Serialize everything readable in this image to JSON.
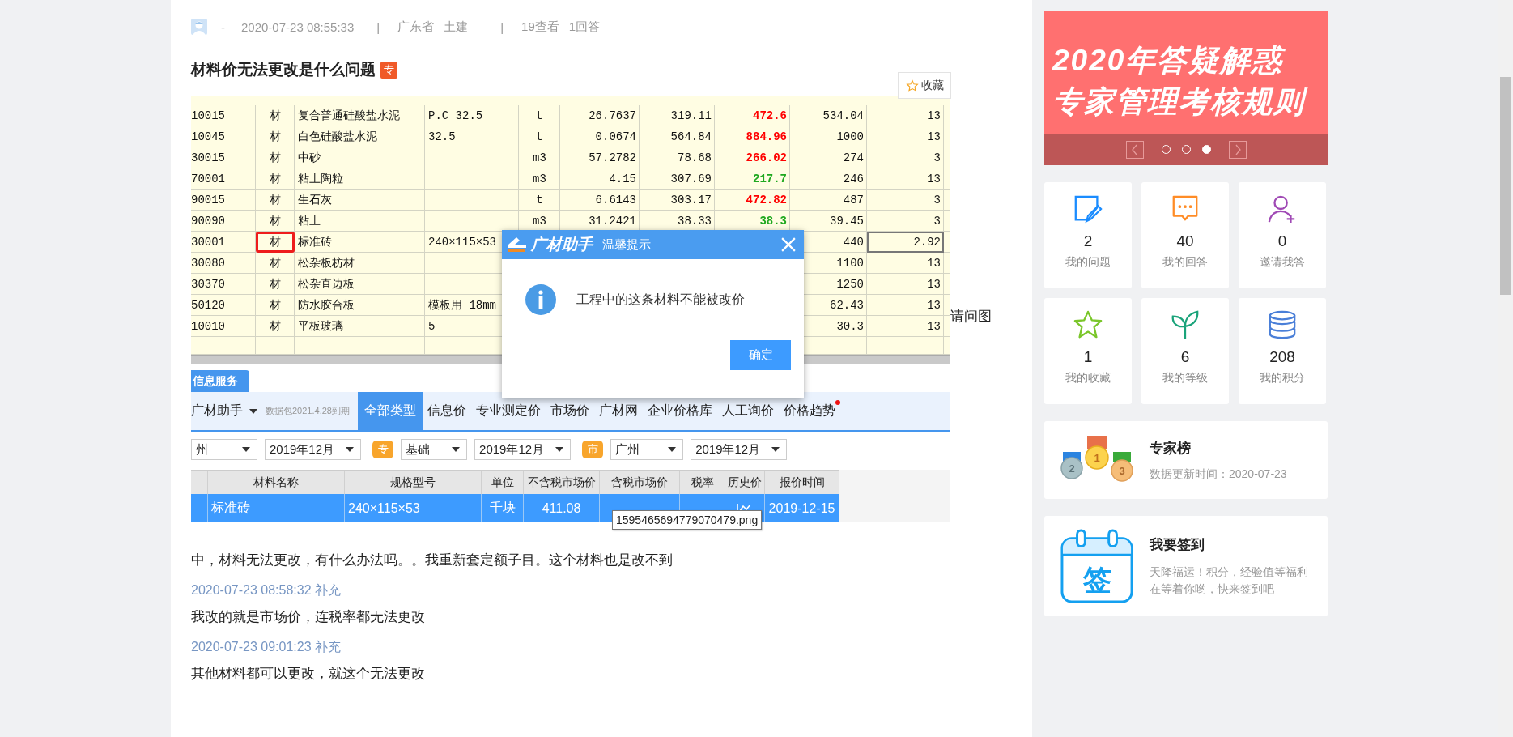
{
  "question": {
    "meta": [
      {
        "kind": "author",
        "text": "-"
      },
      {
        "kind": "time",
        "text": "2020-07-23 08:55:33"
      },
      {
        "kind": "separator",
        "text": "|"
      },
      {
        "kind": "tag",
        "text": "广东省"
      },
      {
        "kind": "tag",
        "text": "土建"
      },
      {
        "kind": "separator",
        "text": "|"
      },
      {
        "kind": "tag",
        "text": "19查看"
      },
      {
        "kind": "tag",
        "text": "1回答"
      }
    ],
    "title": "材料价无法更改是什么问题",
    "badge": "专",
    "favorite_button": "收藏",
    "lead_text": "请问图",
    "screenshot": {
      "price_table": {
        "rows": [
          {
            "flagged": false,
            "focused": false,
            "cells": [
              {
                "text": "10015"
              },
              {
                "text": "材"
              },
              {
                "text": "复合普通硅酸盐水泥"
              },
              {
                "text": "P.C 32.5"
              },
              {
                "text": "t"
              },
              {
                "text": "26.7637"
              },
              {
                "text": "319.11"
              },
              {
                "text": "472.6",
                "color": "#ff0000"
              },
              {
                "text": "534.04"
              },
              {
                "text": "13"
              }
            ]
          },
          {
            "flagged": false,
            "focused": false,
            "cells": [
              {
                "text": "10045"
              },
              {
                "text": "材"
              },
              {
                "text": "白色硅酸盐水泥"
              },
              {
                "text": "32.5"
              },
              {
                "text": "t"
              },
              {
                "text": "0.0674"
              },
              {
                "text": "564.84"
              },
              {
                "text": "884.96",
                "color": "#ff0000"
              },
              {
                "text": "1000"
              },
              {
                "text": "13"
              }
            ]
          },
          {
            "flagged": false,
            "focused": false,
            "cells": [
              {
                "text": "30015"
              },
              {
                "text": "材"
              },
              {
                "text": "中砂"
              },
              {},
              {
                "text": "m3"
              },
              {
                "text": "57.2782"
              },
              {
                "text": "78.68"
              },
              {
                "text": "266.02",
                "color": "#ff0000"
              },
              {
                "text": "274"
              },
              {
                "text": "3"
              }
            ]
          },
          {
            "flagged": false,
            "focused": false,
            "cells": [
              {
                "text": "70001"
              },
              {
                "text": "材"
              },
              {
                "text": "粘土陶粒"
              },
              {},
              {
                "text": "m3"
              },
              {
                "text": "4.15"
              },
              {
                "text": "307.69"
              },
              {
                "text": "217.7",
                "color": "#1fa81f"
              },
              {
                "text": "246"
              },
              {
                "text": "13"
              }
            ]
          },
          {
            "flagged": false,
            "focused": false,
            "cells": [
              {
                "text": "90015"
              },
              {
                "text": "材"
              },
              {
                "text": "生石灰"
              },
              {},
              {
                "text": "t"
              },
              {
                "text": "6.6143"
              },
              {
                "text": "303.17"
              },
              {
                "text": "472.82",
                "color": "#ff0000"
              },
              {
                "text": "487"
              },
              {
                "text": "3"
              }
            ]
          },
          {
            "flagged": false,
            "focused": false,
            "cells": [
              {
                "text": "90090"
              },
              {
                "text": "材"
              },
              {
                "text": "粘土"
              },
              {},
              {
                "text": "m3"
              },
              {
                "text": "31.2421"
              },
              {
                "text": "38.33"
              },
              {
                "text": "38.3",
                "color": "#1fa81f"
              },
              {
                "text": "39.45"
              },
              {
                "text": "3"
              }
            ]
          },
          {
            "flagged": true,
            "focused": true,
            "cells": [
              {
                "text": "30001"
              },
              {
                "text": "材"
              },
              {
                "text": "标准砖"
              },
              {
                "text": "240×115×53"
              },
              {},
              {},
              {},
              {},
              {
                "text": "440"
              },
              {
                "text": "2.92"
              }
            ]
          },
          {
            "flagged": false,
            "focused": false,
            "cells": [
              {
                "text": "30080"
              },
              {
                "text": "材"
              },
              {
                "text": "松杂板枋材"
              },
              {},
              {},
              {},
              {},
              {},
              {
                "text": "1100"
              },
              {
                "text": "13"
              }
            ]
          },
          {
            "flagged": false,
            "focused": false,
            "cells": [
              {
                "text": "30370"
              },
              {
                "text": "材"
              },
              {
                "text": "松杂直边板"
              },
              {},
              {},
              {},
              {},
              {},
              {
                "text": "1250"
              },
              {
                "text": "13"
              }
            ]
          },
          {
            "flagged": false,
            "focused": false,
            "cells": [
              {
                "text": "50120"
              },
              {
                "text": "材"
              },
              {
                "text": "防水胶合板"
              },
              {
                "text": "模板用 18mm"
              },
              {},
              {},
              {},
              {},
              {
                "text": "62.43"
              },
              {
                "text": "13"
              }
            ]
          },
          {
            "flagged": false,
            "focused": false,
            "cells": [
              {
                "text": "10010"
              },
              {
                "text": "材"
              },
              {
                "text": "平板玻璃"
              },
              {
                "text": "5"
              },
              {},
              {},
              {},
              {},
              {
                "text": "30.3"
              },
              {
                "text": "13"
              }
            ]
          }
        ]
      },
      "tab": "信息服务",
      "toolbar": {
        "app": "广材助手",
        "expiry": "数据包2021.4.28到期",
        "categories": [
          {
            "label": "全部类型",
            "selected": true,
            "dot": false
          },
          {
            "label": "信息价",
            "selected": false,
            "dot": false
          },
          {
            "label": "专业测定价",
            "selected": false,
            "dot": false
          },
          {
            "label": "市场价",
            "selected": false,
            "dot": false
          },
          {
            "label": "广材网",
            "selected": false,
            "dot": false
          },
          {
            "label": "企业价格库",
            "selected": false,
            "dot": false
          },
          {
            "label": "人工询价",
            "selected": false,
            "dot": false
          },
          {
            "label": "价格趋势",
            "selected": false,
            "dot": true
          }
        ]
      },
      "filters": [
        {
          "kind": "select",
          "text": "州"
        },
        {
          "kind": "select",
          "text": "2019年12月"
        },
        {
          "kind": "tag",
          "text": "专"
        },
        {
          "kind": "select",
          "text": "基础"
        },
        {
          "kind": "select",
          "text": "2019年12月"
        },
        {
          "kind": "tag",
          "text": "市"
        },
        {
          "kind": "select",
          "text": "广州"
        },
        {
          "kind": "select",
          "text": "2019年12月"
        }
      ],
      "results": {
        "columns": [
          "材料名称",
          "规格型号",
          "单位",
          "不含税市场价",
          "含税市场价",
          "税率",
          "历史价",
          "报价时间"
        ],
        "rows": [
          {
            "selected": true,
            "cells": [
              {
                "kind": "text",
                "text": "标准砖"
              },
              {
                "kind": "text",
                "text": "240×115×53"
              },
              {
                "kind": "text",
                "text": "千块"
              },
              {
                "kind": "text",
                "text": "411.08"
              },
              {},
              {},
              {
                "kind": "chart"
              },
              {
                "kind": "text",
                "text": "2019-12-15"
              }
            ]
          }
        ]
      },
      "dialog": {
        "logo": "广材助手",
        "title": "温馨提示",
        "message": "工程中的这条材料不能被改价",
        "button": "确定"
      },
      "tooltip": "1595465694779070479.png"
    },
    "continuation": "中，材料无法更改，有什么办法吗。。我重新套定额子目。这个材料也是改不到",
    "supplements": [
      {
        "time": "2020-07-23 08:58:32",
        "label": "补充",
        "text": "我改的就是市场价，连税率都无法更改"
      },
      {
        "time": "2020-07-23 09:01:23",
        "label": "补充",
        "text": "其他材料都可以更改，就这个无法更改"
      }
    ]
  },
  "sidebar": {
    "banner": {
      "lines": [
        "2020年答疑解惑",
        "专家管理考核规则"
      ],
      "slides": [
        {
          "selected": false
        },
        {
          "selected": false
        },
        {
          "selected": true
        }
      ]
    },
    "stats": [
      {
        "kind": "questions",
        "count": "2",
        "label": "我的问题"
      },
      {
        "kind": "answers",
        "count": "40",
        "label": "我的回答"
      },
      {
        "kind": "invite",
        "count": "0",
        "label": "邀请我答"
      },
      {
        "kind": "favorites",
        "count": "1",
        "label": "我的收藏"
      },
      {
        "kind": "level",
        "count": "6",
        "label": "我的等级"
      },
      {
        "kind": "points",
        "count": "208",
        "label": "我的积分"
      }
    ],
    "leaderboard": {
      "title": "专家榜",
      "subtitle": "数据更新时间：2020-07-23",
      "medals": [
        "2",
        "1",
        "3"
      ]
    },
    "checkin": {
      "icon_text": "签",
      "title": "我要签到",
      "text": "天降福运！积分，经验值等福利在等着你哟，快来签到吧"
    }
  }
}
